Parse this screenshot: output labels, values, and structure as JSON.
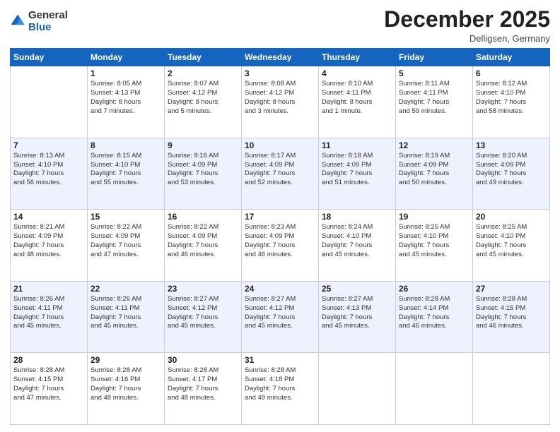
{
  "logo": {
    "general": "General",
    "blue": "Blue"
  },
  "header": {
    "month": "December 2025",
    "location": "Delligsen, Germany"
  },
  "days_of_week": [
    "Sunday",
    "Monday",
    "Tuesday",
    "Wednesday",
    "Thursday",
    "Friday",
    "Saturday"
  ],
  "weeks": [
    [
      {
        "day": "",
        "info": ""
      },
      {
        "day": "1",
        "info": "Sunrise: 8:05 AM\nSunset: 4:13 PM\nDaylight: 8 hours\nand 7 minutes."
      },
      {
        "day": "2",
        "info": "Sunrise: 8:07 AM\nSunset: 4:12 PM\nDaylight: 8 hours\nand 5 minutes."
      },
      {
        "day": "3",
        "info": "Sunrise: 8:08 AM\nSunset: 4:12 PM\nDaylight: 8 hours\nand 3 minutes."
      },
      {
        "day": "4",
        "info": "Sunrise: 8:10 AM\nSunset: 4:11 PM\nDaylight: 8 hours\nand 1 minute."
      },
      {
        "day": "5",
        "info": "Sunrise: 8:11 AM\nSunset: 4:11 PM\nDaylight: 7 hours\nand 59 minutes."
      },
      {
        "day": "6",
        "info": "Sunrise: 8:12 AM\nSunset: 4:10 PM\nDaylight: 7 hours\nand 58 minutes."
      }
    ],
    [
      {
        "day": "7",
        "info": "Sunrise: 8:13 AM\nSunset: 4:10 PM\nDaylight: 7 hours\nand 56 minutes."
      },
      {
        "day": "8",
        "info": "Sunrise: 8:15 AM\nSunset: 4:10 PM\nDaylight: 7 hours\nand 55 minutes."
      },
      {
        "day": "9",
        "info": "Sunrise: 8:16 AM\nSunset: 4:09 PM\nDaylight: 7 hours\nand 53 minutes."
      },
      {
        "day": "10",
        "info": "Sunrise: 8:17 AM\nSunset: 4:09 PM\nDaylight: 7 hours\nand 52 minutes."
      },
      {
        "day": "11",
        "info": "Sunrise: 8:18 AM\nSunset: 4:09 PM\nDaylight: 7 hours\nand 51 minutes."
      },
      {
        "day": "12",
        "info": "Sunrise: 8:19 AM\nSunset: 4:09 PM\nDaylight: 7 hours\nand 50 minutes."
      },
      {
        "day": "13",
        "info": "Sunrise: 8:20 AM\nSunset: 4:09 PM\nDaylight: 7 hours\nand 49 minutes."
      }
    ],
    [
      {
        "day": "14",
        "info": "Sunrise: 8:21 AM\nSunset: 4:09 PM\nDaylight: 7 hours\nand 48 minutes."
      },
      {
        "day": "15",
        "info": "Sunrise: 8:22 AM\nSunset: 4:09 PM\nDaylight: 7 hours\nand 47 minutes."
      },
      {
        "day": "16",
        "info": "Sunrise: 8:22 AM\nSunset: 4:09 PM\nDaylight: 7 hours\nand 46 minutes."
      },
      {
        "day": "17",
        "info": "Sunrise: 8:23 AM\nSunset: 4:09 PM\nDaylight: 7 hours\nand 46 minutes."
      },
      {
        "day": "18",
        "info": "Sunrise: 8:24 AM\nSunset: 4:10 PM\nDaylight: 7 hours\nand 45 minutes."
      },
      {
        "day": "19",
        "info": "Sunrise: 8:25 AM\nSunset: 4:10 PM\nDaylight: 7 hours\nand 45 minutes."
      },
      {
        "day": "20",
        "info": "Sunrise: 8:25 AM\nSunset: 4:10 PM\nDaylight: 7 hours\nand 45 minutes."
      }
    ],
    [
      {
        "day": "21",
        "info": "Sunrise: 8:26 AM\nSunset: 4:11 PM\nDaylight: 7 hours\nand 45 minutes."
      },
      {
        "day": "22",
        "info": "Sunrise: 8:26 AM\nSunset: 4:11 PM\nDaylight: 7 hours\nand 45 minutes."
      },
      {
        "day": "23",
        "info": "Sunrise: 8:27 AM\nSunset: 4:12 PM\nDaylight: 7 hours\nand 45 minutes."
      },
      {
        "day": "24",
        "info": "Sunrise: 8:27 AM\nSunset: 4:12 PM\nDaylight: 7 hours\nand 45 minutes."
      },
      {
        "day": "25",
        "info": "Sunrise: 8:27 AM\nSunset: 4:13 PM\nDaylight: 7 hours\nand 45 minutes."
      },
      {
        "day": "26",
        "info": "Sunrise: 8:28 AM\nSunset: 4:14 PM\nDaylight: 7 hours\nand 46 minutes."
      },
      {
        "day": "27",
        "info": "Sunrise: 8:28 AM\nSunset: 4:15 PM\nDaylight: 7 hours\nand 46 minutes."
      }
    ],
    [
      {
        "day": "28",
        "info": "Sunrise: 8:28 AM\nSunset: 4:15 PM\nDaylight: 7 hours\nand 47 minutes."
      },
      {
        "day": "29",
        "info": "Sunrise: 8:28 AM\nSunset: 4:16 PM\nDaylight: 7 hours\nand 48 minutes."
      },
      {
        "day": "30",
        "info": "Sunrise: 8:28 AM\nSunset: 4:17 PM\nDaylight: 7 hours\nand 48 minutes."
      },
      {
        "day": "31",
        "info": "Sunrise: 8:28 AM\nSunset: 4:18 PM\nDaylight: 7 hours\nand 49 minutes."
      },
      {
        "day": "",
        "info": ""
      },
      {
        "day": "",
        "info": ""
      },
      {
        "day": "",
        "info": ""
      }
    ]
  ]
}
